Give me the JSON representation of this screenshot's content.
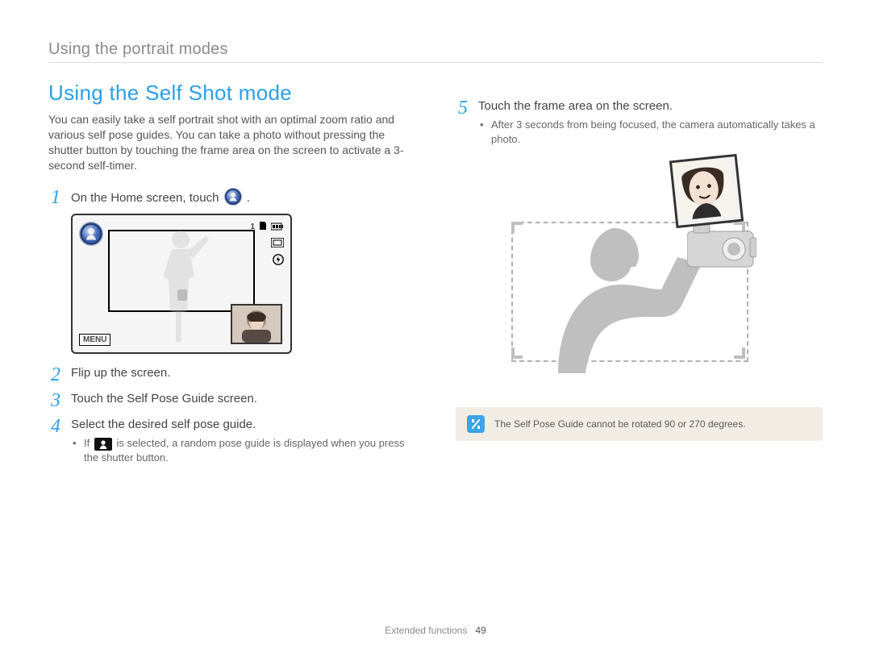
{
  "header": {
    "section": "Using the portrait modes"
  },
  "title": "Using the Self Shot mode",
  "intro": "You can easily take a self portrait shot with an optimal zoom ratio and various self pose guides. You can take a photo without pressing the shutter button by touching the frame area on the screen to activate a 3-second self-timer.",
  "lcd": {
    "menu": "MENU",
    "count": "1"
  },
  "steps": [
    {
      "num": "1",
      "text_before": "On the Home screen, touch ",
      "text_after": ".",
      "has_mode_icon": true
    },
    {
      "num": "2",
      "text": "Flip up the screen."
    },
    {
      "num": "3",
      "text": "Touch the Self Pose Guide screen."
    },
    {
      "num": "4",
      "text": "Select the desired self pose guide.",
      "sub": {
        "before": "If ",
        "after": " is selected, a random pose guide is displayed when you press the shutter button.",
        "has_random_icon": true
      }
    }
  ],
  "right_step": {
    "num": "5",
    "text": "Touch the frame area on the screen.",
    "sub": "After 3 seconds from being focused, the camera automatically takes a photo."
  },
  "note": "The Self Pose Guide cannot be rotated 90 or 270 degrees.",
  "footer": {
    "chapter": "Extended functions",
    "page": "49"
  }
}
